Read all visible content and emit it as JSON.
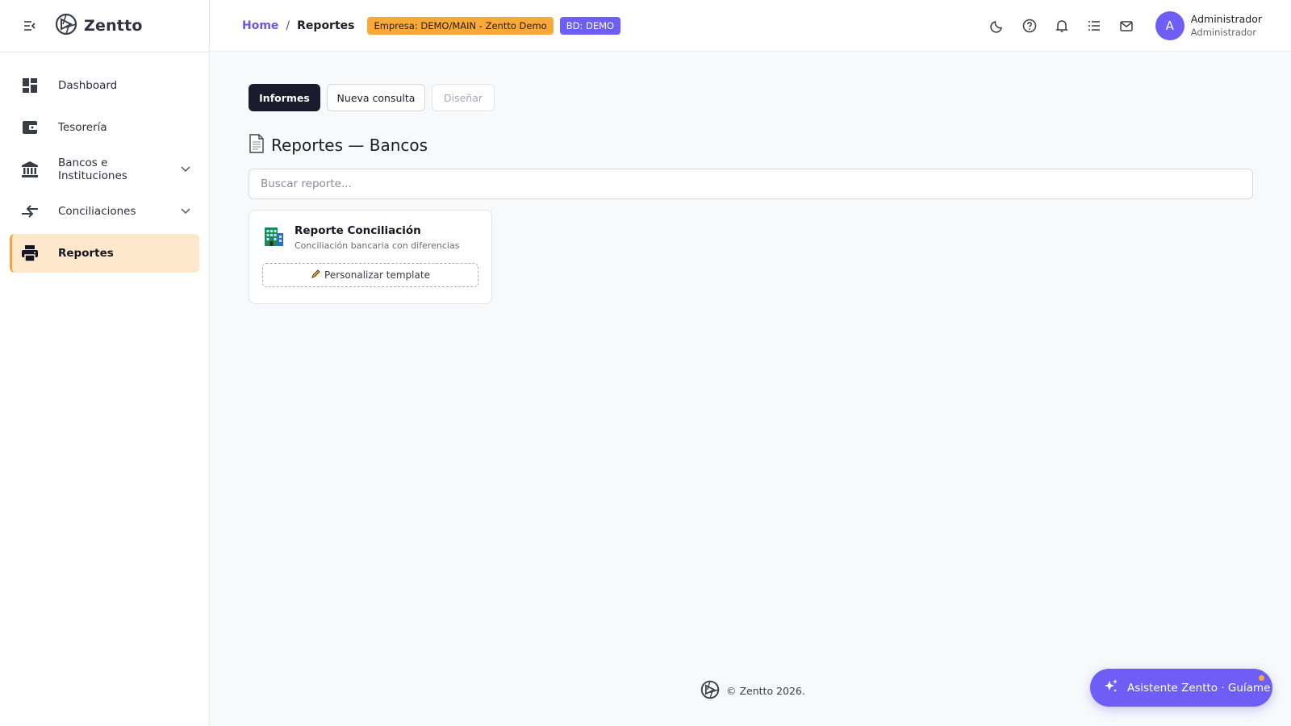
{
  "brand": {
    "name": "Zentto"
  },
  "sidebar": {
    "items": [
      {
        "label": "Dashboard",
        "icon": "dashboard-icon"
      },
      {
        "label": "Tesorería",
        "icon": "wallet-icon"
      },
      {
        "label": "Bancos e Instituciones",
        "icon": "bank-icon",
        "expandable": true
      },
      {
        "label": "Conciliaciones",
        "icon": "compare-arrows-icon",
        "expandable": true
      },
      {
        "label": "Reportes",
        "icon": "printer-icon",
        "active": true
      }
    ]
  },
  "header": {
    "breadcrumb": {
      "home": "Home",
      "separator": "/",
      "current": "Reportes"
    },
    "badges": {
      "empresa": "Empresa: DEMO/MAIN - Zentto Demo",
      "bd": "BD: DEMO"
    },
    "icons": [
      "moon-icon",
      "help-icon",
      "bell-icon",
      "list-icon",
      "mail-icon"
    ],
    "user": {
      "initial": "A",
      "name": "Administrador",
      "role": "Administrador"
    }
  },
  "main": {
    "tabs": {
      "informes": "Informes",
      "nueva_consulta": "Nueva consulta",
      "disenar": "Diseñar"
    },
    "title": "Reportes — Bancos",
    "search": {
      "placeholder": "Buscar reporte...",
      "value": ""
    },
    "cards": [
      {
        "title": "Reporte Conciliación",
        "description": "Conciliación bancaria con diferencias",
        "action": "Personalizar template",
        "icon": "building-icon"
      }
    ]
  },
  "footer": {
    "text": "© Zentto 2026."
  },
  "assistant": {
    "label": "Asistente Zentto · Guíame"
  },
  "colors": {
    "accent": "#6e5ef5",
    "active_bg": "#fde8cc",
    "warning": "#f8a93a",
    "dark": "#1c1b2e"
  }
}
